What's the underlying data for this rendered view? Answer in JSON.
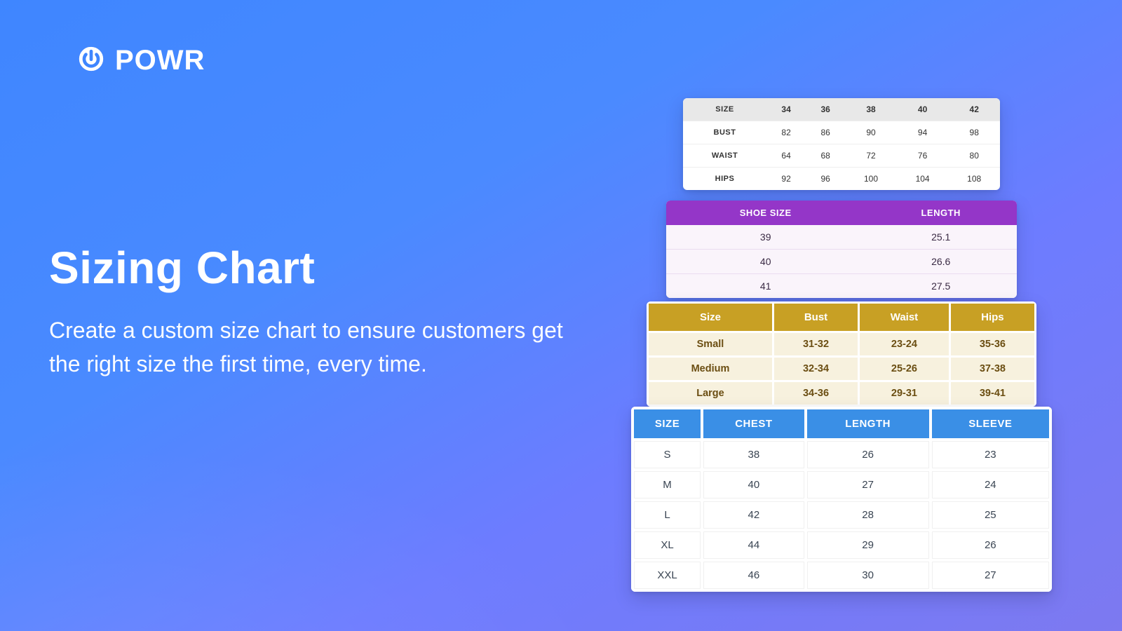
{
  "brand": {
    "name": "POWR"
  },
  "hero": {
    "title": "Sizing Chart",
    "subtitle": "Create a custom size chart to ensure customers get the right size the first time, every time."
  },
  "charts": {
    "body_matrix": {
      "row_labels": [
        "SIZE",
        "BUST",
        "WAIST",
        "HIPS"
      ],
      "cols": [
        "34",
        "36",
        "38",
        "40",
        "42"
      ],
      "rows": [
        [
          "82",
          "86",
          "90",
          "94",
          "98"
        ],
        [
          "64",
          "68",
          "72",
          "76",
          "80"
        ],
        [
          "92",
          "96",
          "100",
          "104",
          "108"
        ]
      ]
    },
    "shoe": {
      "headers": [
        "SHOE SIZE",
        "LENGTH"
      ],
      "rows": [
        [
          "39",
          "25.1"
        ],
        [
          "40",
          "26.6"
        ],
        [
          "41",
          "27.5"
        ]
      ]
    },
    "gold": {
      "headers": [
        "Size",
        "Bust",
        "Waist",
        "Hips"
      ],
      "rows": [
        [
          "Small",
          "31-32",
          "23-24",
          "35-36"
        ],
        [
          "Medium",
          "32-34",
          "25-26",
          "37-38"
        ],
        [
          "Large",
          "34-36",
          "29-31",
          "39-41"
        ]
      ]
    },
    "blue": {
      "headers": [
        "SIZE",
        "CHEST",
        "LENGTH",
        "SLEEVE"
      ],
      "rows": [
        [
          "S",
          "38",
          "26",
          "23"
        ],
        [
          "M",
          "40",
          "27",
          "24"
        ],
        [
          "L",
          "42",
          "28",
          "25"
        ],
        [
          "XL",
          "44",
          "29",
          "26"
        ],
        [
          "XXL",
          "46",
          "30",
          "27"
        ]
      ]
    }
  }
}
